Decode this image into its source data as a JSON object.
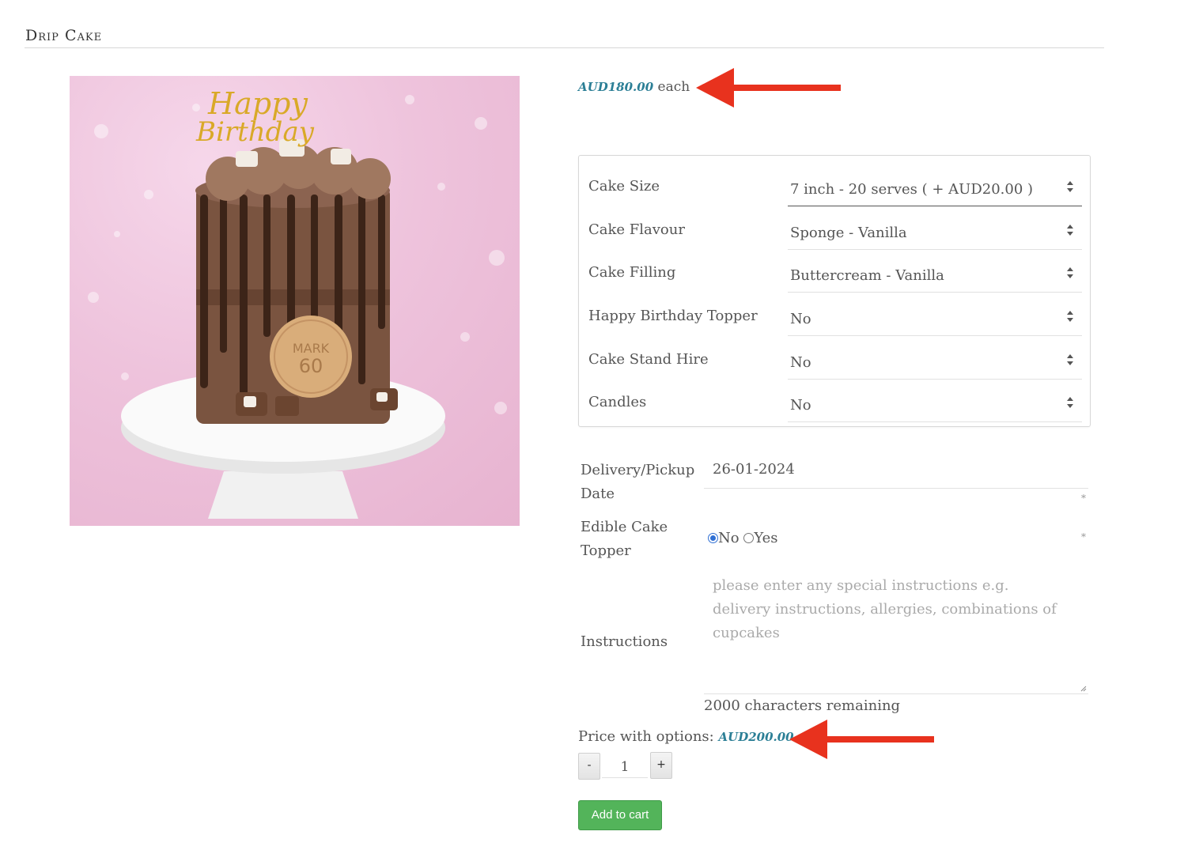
{
  "product": {
    "title": "Drip Cake",
    "image_alt": "Chocolate drip cake with Happy Birthday topper and MARK 60 cookie on white cake stand",
    "image_topper_text": "Happy Birthday",
    "image_cookie_text": "MARK 60",
    "price": "AUD180.00",
    "price_suffix": "each"
  },
  "options": [
    {
      "label": "Cake Size",
      "value": "7 inch - 20 serves ( + AUD20.00 )"
    },
    {
      "label": "Cake Flavour",
      "value": "Sponge - Vanilla"
    },
    {
      "label": "Cake Filling",
      "value": "Buttercream - Vanilla"
    },
    {
      "label": "Happy Birthday Topper",
      "value": "No"
    },
    {
      "label": "Cake Stand Hire",
      "value": "No"
    },
    {
      "label": "Candles",
      "value": "No"
    }
  ],
  "form": {
    "date_label_line1": "Delivery/Pickup",
    "date_label_line2": "Date",
    "date_value": "26-01-2024",
    "topper_label_line1": "Edible Cake",
    "topper_label_line2": "Topper",
    "topper_options": [
      "No",
      "Yes"
    ],
    "topper_selected": "No",
    "required_mark": "*",
    "instructions_label": "Instructions",
    "instructions_placeholder": "please enter any special instructions e.g. delivery instructions, allergies, combinations of cupcakes",
    "chars_remaining": "2000 characters remaining"
  },
  "summary": {
    "price_with_options_label": "Price with options:",
    "price_with_options_value": "AUD200.00",
    "minus_label": "-",
    "plus_label": "+",
    "quantity": "1",
    "add_to_cart_label": "Add to cart"
  },
  "colors": {
    "price": "#2c7f96",
    "button": "#53b45a",
    "annotation_arrow": "#e8321e",
    "radio_checked": "#2f6fd4"
  }
}
